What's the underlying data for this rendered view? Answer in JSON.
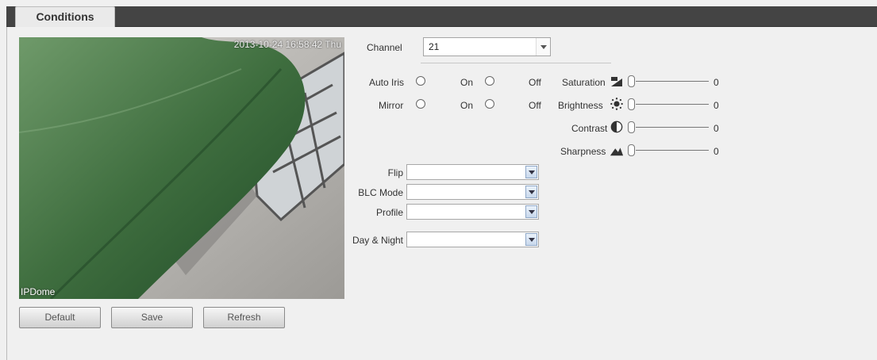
{
  "header": {
    "tab_label": "Conditions"
  },
  "video": {
    "timestamp": "2013-10-24 16:58:42 Thu",
    "camera_name": "IPDome"
  },
  "buttons": {
    "default_label": "Default",
    "save_label": "Save",
    "refresh_label": "Refresh"
  },
  "channel": {
    "label": "Channel",
    "value": "21"
  },
  "auto_iris": {
    "label": "Auto Iris",
    "on_label": "On",
    "off_label": "Off"
  },
  "mirror": {
    "label": "Mirror",
    "on_label": "On",
    "off_label": "Off"
  },
  "sliders": [
    {
      "label": "Saturation",
      "icon": "saturation-icon",
      "value": "0"
    },
    {
      "label": "Brightness",
      "icon": "brightness-icon",
      "value": "0"
    },
    {
      "label": "Contrast",
      "icon": "contrast-icon",
      "value": "0"
    },
    {
      "label": "Sharpness",
      "icon": "sharpness-icon",
      "value": "0"
    }
  ],
  "dropdowns": [
    {
      "label": "Flip",
      "value": ""
    },
    {
      "label": "BLC Mode",
      "value": ""
    },
    {
      "label": "Profile",
      "value": ""
    },
    {
      "label": "Day & Night",
      "value": ""
    }
  ]
}
